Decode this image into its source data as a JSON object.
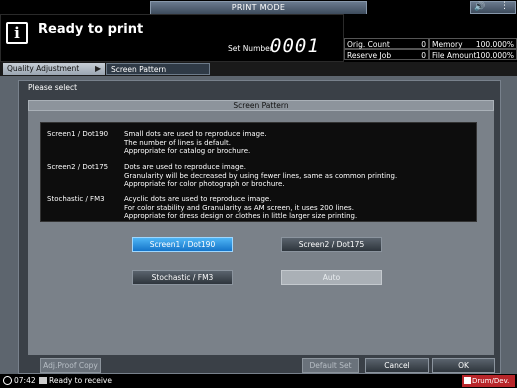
{
  "top_bar": {
    "mode_tab": "PRINT MODE",
    "volume_icon": "speaker-icon",
    "menu_icon": "dots-icon"
  },
  "status": {
    "icon": "info-icon",
    "title": "Ready to print",
    "set_number_label": "Set Number",
    "set_number_value": "0001"
  },
  "counters": {
    "orig_count_label": "Orig. Count",
    "orig_count_value": "0",
    "reserve_job_label": "Reserve Job",
    "reserve_job_value": "0",
    "memory_label": "Memory",
    "memory_value": "100.000%",
    "file_amount_label": "File Amount",
    "file_amount_value": "100.000%"
  },
  "breadcrumb": {
    "parent": "Quality Adjustment",
    "current": "Screen Pattern"
  },
  "dialog": {
    "prompt": "Please select",
    "title": "Screen Pattern",
    "descriptions": [
      {
        "name": "Screen1 / Dot190",
        "lines": [
          "Small dots are used to reproduce image.",
          "The number of lines is default.",
          "Appropriate for catalog or brochure."
        ]
      },
      {
        "name": "Screen2 / Dot175",
        "lines": [
          "Dots are used to reproduce image.",
          "Granularity will be decreased by using fewer lines, same as common printing.",
          "Appropriate for color photograph or brochure."
        ]
      },
      {
        "name": "Stochastic / FM3",
        "lines": [
          "Acyclic dots are used to reproduce image.",
          "For color stability and Granularity as AM screen, it uses 200 lines.",
          "Appropriate for dress design or clothes in little larger size printing."
        ]
      }
    ],
    "options": {
      "screen1": "Screen1 / Dot190",
      "screen2": "Screen2 / Dot175",
      "stochastic": "Stochastic / FM3",
      "auto": "Auto"
    }
  },
  "footer": {
    "adj_proof_copy": "Adj.Proof Copy",
    "default_set": "Default Set",
    "cancel": "Cancel",
    "ok": "OK",
    "time": "07:42",
    "status": "Ready to receive",
    "drum_badge": "Drum/Dev."
  }
}
